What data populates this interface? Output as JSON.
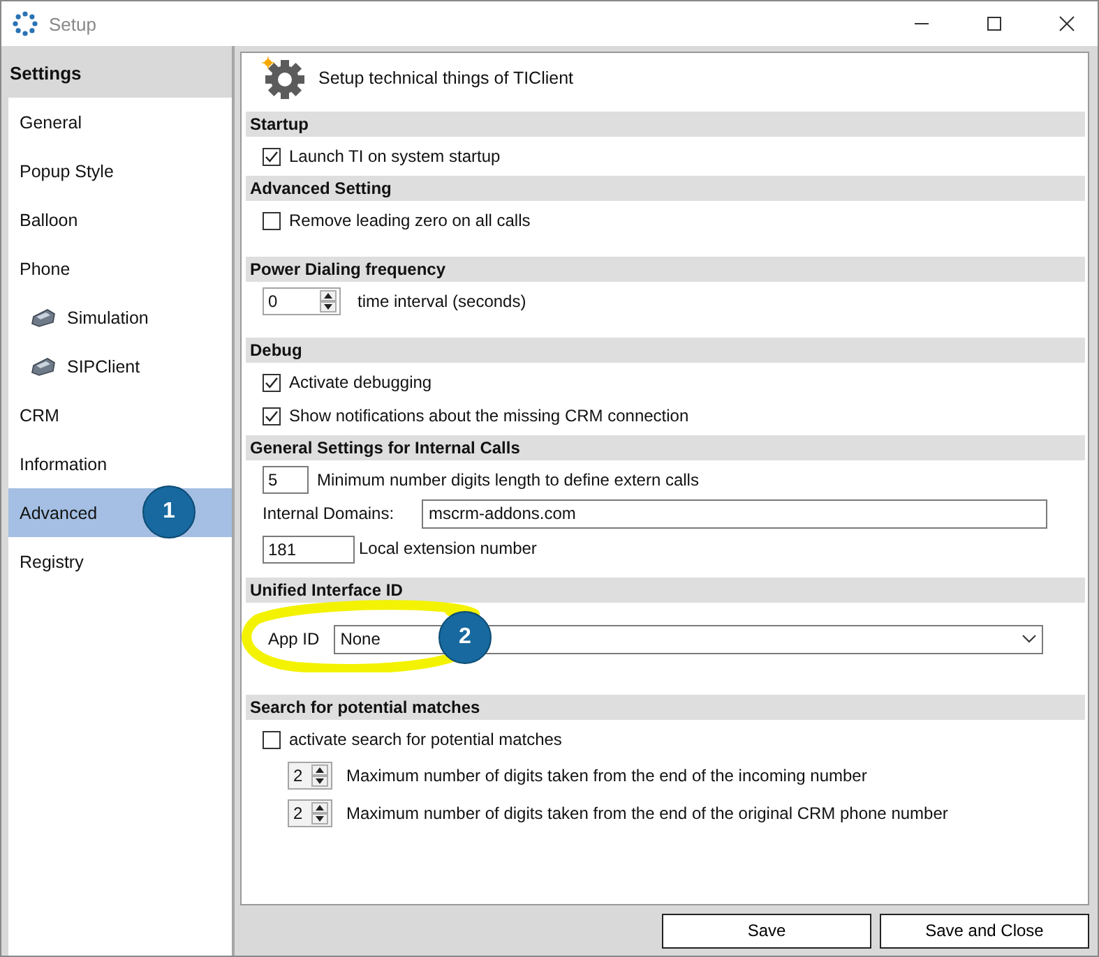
{
  "window": {
    "title": "Setup"
  },
  "sidebar": {
    "title": "Settings",
    "items": [
      {
        "label": "General",
        "selected": false
      },
      {
        "label": "Popup Style",
        "selected": false
      },
      {
        "label": "Balloon",
        "selected": false
      },
      {
        "label": "Phone",
        "selected": false,
        "children": [
          {
            "label": "Simulation",
            "selected": false
          },
          {
            "label": "SIPClient",
            "selected": false
          }
        ]
      },
      {
        "label": "CRM",
        "selected": false
      },
      {
        "label": "Information",
        "selected": false
      },
      {
        "label": "Advanced",
        "selected": true,
        "callout": "1"
      },
      {
        "label": "Registry",
        "selected": false
      }
    ]
  },
  "panel": {
    "heading": "Setup technical things of TIClient",
    "sections": [
      {
        "title": "Startup",
        "highlighted": false,
        "rows": [
          {
            "kind": "checkbox",
            "label": "Launch TI on system startup",
            "checked": true
          }
        ]
      },
      {
        "title": "Advanced Setting",
        "highlighted": false,
        "rows": [
          {
            "kind": "checkbox",
            "label": "Remove leading zero on all calls",
            "checked": false
          }
        ]
      },
      {
        "title": "Power Dialing frequency",
        "highlighted": false,
        "rows": [
          {
            "kind": "spinner",
            "value": "0",
            "caption": "time interval (seconds)"
          }
        ]
      },
      {
        "title": "Debug",
        "highlighted": false,
        "rows": [
          {
            "kind": "checkbox",
            "label": "Activate debugging",
            "checked": true
          },
          {
            "kind": "checkbox",
            "label": "Show notifications about the missing CRM connection",
            "checked": true
          }
        ]
      },
      {
        "title": "General Settings for Internal Calls",
        "highlighted": false,
        "rows": [
          {
            "kind": "number",
            "value": "5",
            "caption": "Minimum number digits length to define extern calls"
          },
          {
            "kind": "text",
            "label": "Internal Domains:",
            "value": "mscrm-addons.com"
          },
          {
            "kind": "number",
            "value": "181",
            "caption": "Local extension number"
          }
        ]
      },
      {
        "title": "Unified Interface ID",
        "highlighted": true,
        "rows": [
          {
            "kind": "dropdown",
            "label": "App ID",
            "value": "None",
            "callout": "2"
          }
        ]
      },
      {
        "title": "Search for potential matches",
        "highlighted": false,
        "rows": [
          {
            "kind": "checkbox",
            "label": "activate search for potential matches",
            "checked": false
          },
          {
            "kind": "mini_spinner",
            "value": "2",
            "caption": "Maximum number of digits taken from the end of the incoming number"
          },
          {
            "kind": "mini_spinner",
            "value": "2",
            "caption": "Maximum number of digits taken from the end of the original CRM phone number"
          }
        ]
      }
    ]
  },
  "buttons": [
    "Save",
    "Save and Close"
  ]
}
